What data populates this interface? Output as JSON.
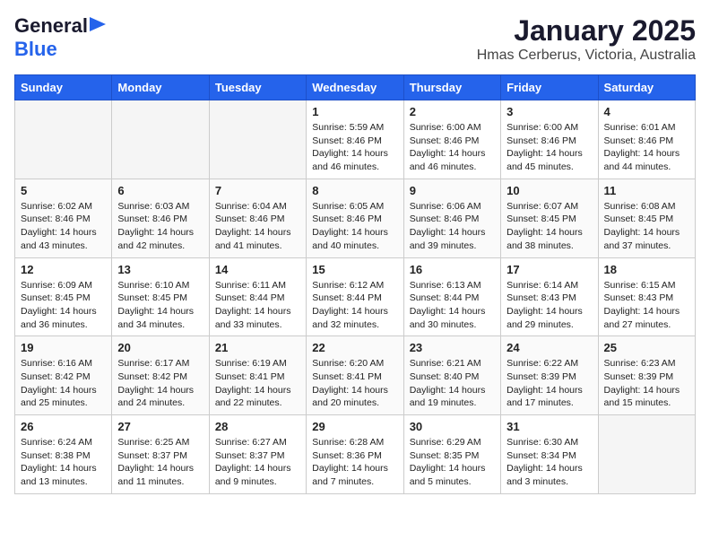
{
  "header": {
    "logo_general": "General",
    "logo_blue": "Blue",
    "title": "January 2025",
    "subtitle": "Hmas Cerberus, Victoria, Australia"
  },
  "days_of_week": [
    "Sunday",
    "Monday",
    "Tuesday",
    "Wednesday",
    "Thursday",
    "Friday",
    "Saturday"
  ],
  "weeks": [
    [
      {
        "day": "",
        "sunrise": "",
        "sunset": "",
        "daylight": ""
      },
      {
        "day": "",
        "sunrise": "",
        "sunset": "",
        "daylight": ""
      },
      {
        "day": "",
        "sunrise": "",
        "sunset": "",
        "daylight": ""
      },
      {
        "day": "1",
        "sunrise": "Sunrise: 5:59 AM",
        "sunset": "Sunset: 8:46 PM",
        "daylight": "Daylight: 14 hours and 46 minutes."
      },
      {
        "day": "2",
        "sunrise": "Sunrise: 6:00 AM",
        "sunset": "Sunset: 8:46 PM",
        "daylight": "Daylight: 14 hours and 46 minutes."
      },
      {
        "day": "3",
        "sunrise": "Sunrise: 6:00 AM",
        "sunset": "Sunset: 8:46 PM",
        "daylight": "Daylight: 14 hours and 45 minutes."
      },
      {
        "day": "4",
        "sunrise": "Sunrise: 6:01 AM",
        "sunset": "Sunset: 8:46 PM",
        "daylight": "Daylight: 14 hours and 44 minutes."
      }
    ],
    [
      {
        "day": "5",
        "sunrise": "Sunrise: 6:02 AM",
        "sunset": "Sunset: 8:46 PM",
        "daylight": "Daylight: 14 hours and 43 minutes."
      },
      {
        "day": "6",
        "sunrise": "Sunrise: 6:03 AM",
        "sunset": "Sunset: 8:46 PM",
        "daylight": "Daylight: 14 hours and 42 minutes."
      },
      {
        "day": "7",
        "sunrise": "Sunrise: 6:04 AM",
        "sunset": "Sunset: 8:46 PM",
        "daylight": "Daylight: 14 hours and 41 minutes."
      },
      {
        "day": "8",
        "sunrise": "Sunrise: 6:05 AM",
        "sunset": "Sunset: 8:46 PM",
        "daylight": "Daylight: 14 hours and 40 minutes."
      },
      {
        "day": "9",
        "sunrise": "Sunrise: 6:06 AM",
        "sunset": "Sunset: 8:46 PM",
        "daylight": "Daylight: 14 hours and 39 minutes."
      },
      {
        "day": "10",
        "sunrise": "Sunrise: 6:07 AM",
        "sunset": "Sunset: 8:45 PM",
        "daylight": "Daylight: 14 hours and 38 minutes."
      },
      {
        "day": "11",
        "sunrise": "Sunrise: 6:08 AM",
        "sunset": "Sunset: 8:45 PM",
        "daylight": "Daylight: 14 hours and 37 minutes."
      }
    ],
    [
      {
        "day": "12",
        "sunrise": "Sunrise: 6:09 AM",
        "sunset": "Sunset: 8:45 PM",
        "daylight": "Daylight: 14 hours and 36 minutes."
      },
      {
        "day": "13",
        "sunrise": "Sunrise: 6:10 AM",
        "sunset": "Sunset: 8:45 PM",
        "daylight": "Daylight: 14 hours and 34 minutes."
      },
      {
        "day": "14",
        "sunrise": "Sunrise: 6:11 AM",
        "sunset": "Sunset: 8:44 PM",
        "daylight": "Daylight: 14 hours and 33 minutes."
      },
      {
        "day": "15",
        "sunrise": "Sunrise: 6:12 AM",
        "sunset": "Sunset: 8:44 PM",
        "daylight": "Daylight: 14 hours and 32 minutes."
      },
      {
        "day": "16",
        "sunrise": "Sunrise: 6:13 AM",
        "sunset": "Sunset: 8:44 PM",
        "daylight": "Daylight: 14 hours and 30 minutes."
      },
      {
        "day": "17",
        "sunrise": "Sunrise: 6:14 AM",
        "sunset": "Sunset: 8:43 PM",
        "daylight": "Daylight: 14 hours and 29 minutes."
      },
      {
        "day": "18",
        "sunrise": "Sunrise: 6:15 AM",
        "sunset": "Sunset: 8:43 PM",
        "daylight": "Daylight: 14 hours and 27 minutes."
      }
    ],
    [
      {
        "day": "19",
        "sunrise": "Sunrise: 6:16 AM",
        "sunset": "Sunset: 8:42 PM",
        "daylight": "Daylight: 14 hours and 25 minutes."
      },
      {
        "day": "20",
        "sunrise": "Sunrise: 6:17 AM",
        "sunset": "Sunset: 8:42 PM",
        "daylight": "Daylight: 14 hours and 24 minutes."
      },
      {
        "day": "21",
        "sunrise": "Sunrise: 6:19 AM",
        "sunset": "Sunset: 8:41 PM",
        "daylight": "Daylight: 14 hours and 22 minutes."
      },
      {
        "day": "22",
        "sunrise": "Sunrise: 6:20 AM",
        "sunset": "Sunset: 8:41 PM",
        "daylight": "Daylight: 14 hours and 20 minutes."
      },
      {
        "day": "23",
        "sunrise": "Sunrise: 6:21 AM",
        "sunset": "Sunset: 8:40 PM",
        "daylight": "Daylight: 14 hours and 19 minutes."
      },
      {
        "day": "24",
        "sunrise": "Sunrise: 6:22 AM",
        "sunset": "Sunset: 8:39 PM",
        "daylight": "Daylight: 14 hours and 17 minutes."
      },
      {
        "day": "25",
        "sunrise": "Sunrise: 6:23 AM",
        "sunset": "Sunset: 8:39 PM",
        "daylight": "Daylight: 14 hours and 15 minutes."
      }
    ],
    [
      {
        "day": "26",
        "sunrise": "Sunrise: 6:24 AM",
        "sunset": "Sunset: 8:38 PM",
        "daylight": "Daylight: 14 hours and 13 minutes."
      },
      {
        "day": "27",
        "sunrise": "Sunrise: 6:25 AM",
        "sunset": "Sunset: 8:37 PM",
        "daylight": "Daylight: 14 hours and 11 minutes."
      },
      {
        "day": "28",
        "sunrise": "Sunrise: 6:27 AM",
        "sunset": "Sunset: 8:37 PM",
        "daylight": "Daylight: 14 hours and 9 minutes."
      },
      {
        "day": "29",
        "sunrise": "Sunrise: 6:28 AM",
        "sunset": "Sunset: 8:36 PM",
        "daylight": "Daylight: 14 hours and 7 minutes."
      },
      {
        "day": "30",
        "sunrise": "Sunrise: 6:29 AM",
        "sunset": "Sunset: 8:35 PM",
        "daylight": "Daylight: 14 hours and 5 minutes."
      },
      {
        "day": "31",
        "sunrise": "Sunrise: 6:30 AM",
        "sunset": "Sunset: 8:34 PM",
        "daylight": "Daylight: 14 hours and 3 minutes."
      },
      {
        "day": "",
        "sunrise": "",
        "sunset": "",
        "daylight": ""
      }
    ]
  ]
}
